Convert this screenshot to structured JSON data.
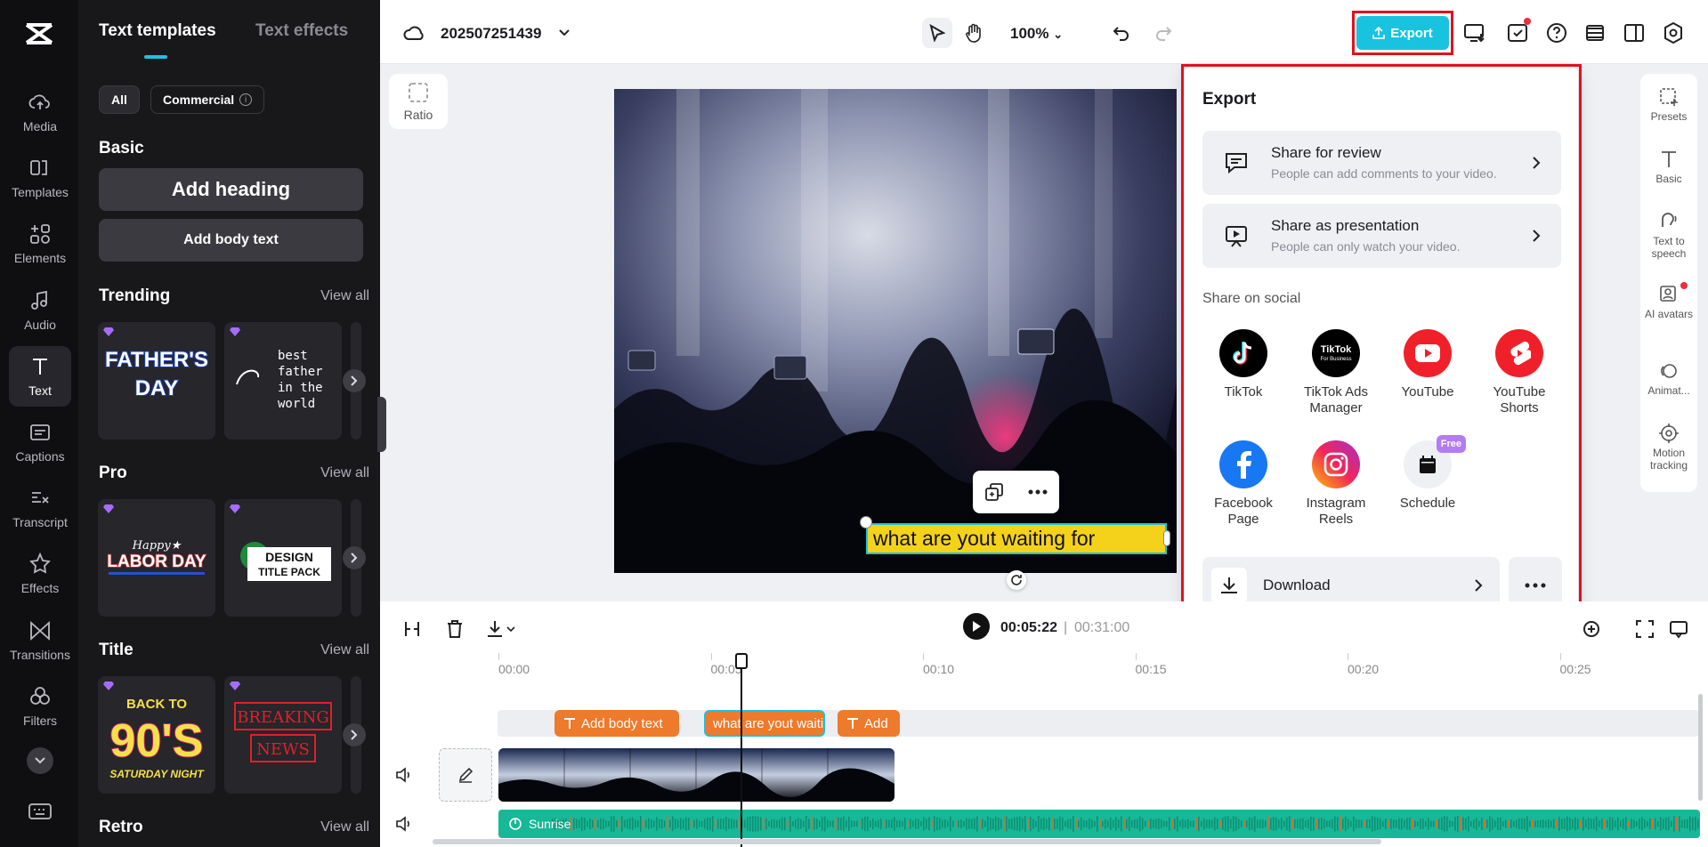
{
  "sidebar": {
    "items": [
      {
        "label": "Media",
        "icon": "cloud-upload-icon"
      },
      {
        "label": "Templates",
        "icon": "templates-icon"
      },
      {
        "label": "Elements",
        "icon": "elements-icon"
      },
      {
        "label": "Audio",
        "icon": "music-note-icon"
      },
      {
        "label": "Text",
        "icon": "text-icon",
        "active": true
      },
      {
        "label": "Captions",
        "icon": "captions-icon"
      },
      {
        "label": "Transcript",
        "icon": "transcript-icon"
      },
      {
        "label": "Effects",
        "icon": "effects-icon"
      },
      {
        "label": "Transitions",
        "icon": "transitions-icon"
      },
      {
        "label": "Filters",
        "icon": "filters-icon"
      }
    ]
  },
  "text_panel": {
    "tabs": [
      "Text templates",
      "Text effects"
    ],
    "chips": [
      "All",
      "Commercial"
    ],
    "basic": {
      "title": "Basic",
      "add_heading": "Add heading",
      "add_body": "Add body text"
    },
    "sections": [
      {
        "title": "Trending",
        "view_all": "View all",
        "cards": [
          "FATHER'S DAY",
          "best father in the world"
        ]
      },
      {
        "title": "Pro",
        "view_all": "View all",
        "cards": [
          "Happy LABOR DAY",
          "DESIGN TITLE PACK"
        ]
      },
      {
        "title": "Title",
        "view_all": "View all",
        "cards": [
          "BACK TO 90'S SATURDAY NIGHT",
          "BREAKING NEWS"
        ]
      },
      {
        "title": "Retro",
        "view_all": "View all"
      }
    ]
  },
  "topbar": {
    "project_name": "202507251439",
    "zoom": "100%",
    "export_label": "Export"
  },
  "canvas": {
    "ratio_label": "Ratio",
    "caption_text": "what are yout waiting for"
  },
  "right_panel": {
    "items": [
      {
        "label": "Presets"
      },
      {
        "label": "Basic"
      },
      {
        "label": "Text to speech"
      },
      {
        "label": "AI avatars"
      },
      {
        "label": "Animat..."
      },
      {
        "label": "Motion tracking"
      }
    ]
  },
  "export_panel": {
    "title": "Export",
    "share_review": {
      "title": "Share for review",
      "subtitle": "People can add comments to your video."
    },
    "share_presentation": {
      "title": "Share as presentation",
      "subtitle": "People can only watch your video."
    },
    "social_title": "Share on social",
    "social": [
      {
        "label": "TikTok"
      },
      {
        "label": "TikTok Ads Manager"
      },
      {
        "label": "YouTube"
      },
      {
        "label": "YouTube Shorts"
      },
      {
        "label": "Facebook Page"
      },
      {
        "label": "Instagram Reels"
      },
      {
        "label": "Schedule",
        "badge": "Free"
      }
    ],
    "download_label": "Download"
  },
  "timeline": {
    "current_time": "00:05:22",
    "separator": "|",
    "total_time": "00:31:00",
    "ruler": [
      "00:00",
      "00:05",
      "00:10",
      "00:15",
      "00:20",
      "00:25"
    ],
    "text_clips": [
      "Add body text",
      "what are yout waiting for",
      "Add"
    ],
    "audio_clip": "Sunrise"
  },
  "colors": {
    "accent": "#19c3e0",
    "highlight": "#e4101c",
    "clip": "#ee7a2c",
    "audio": "#17b897"
  }
}
